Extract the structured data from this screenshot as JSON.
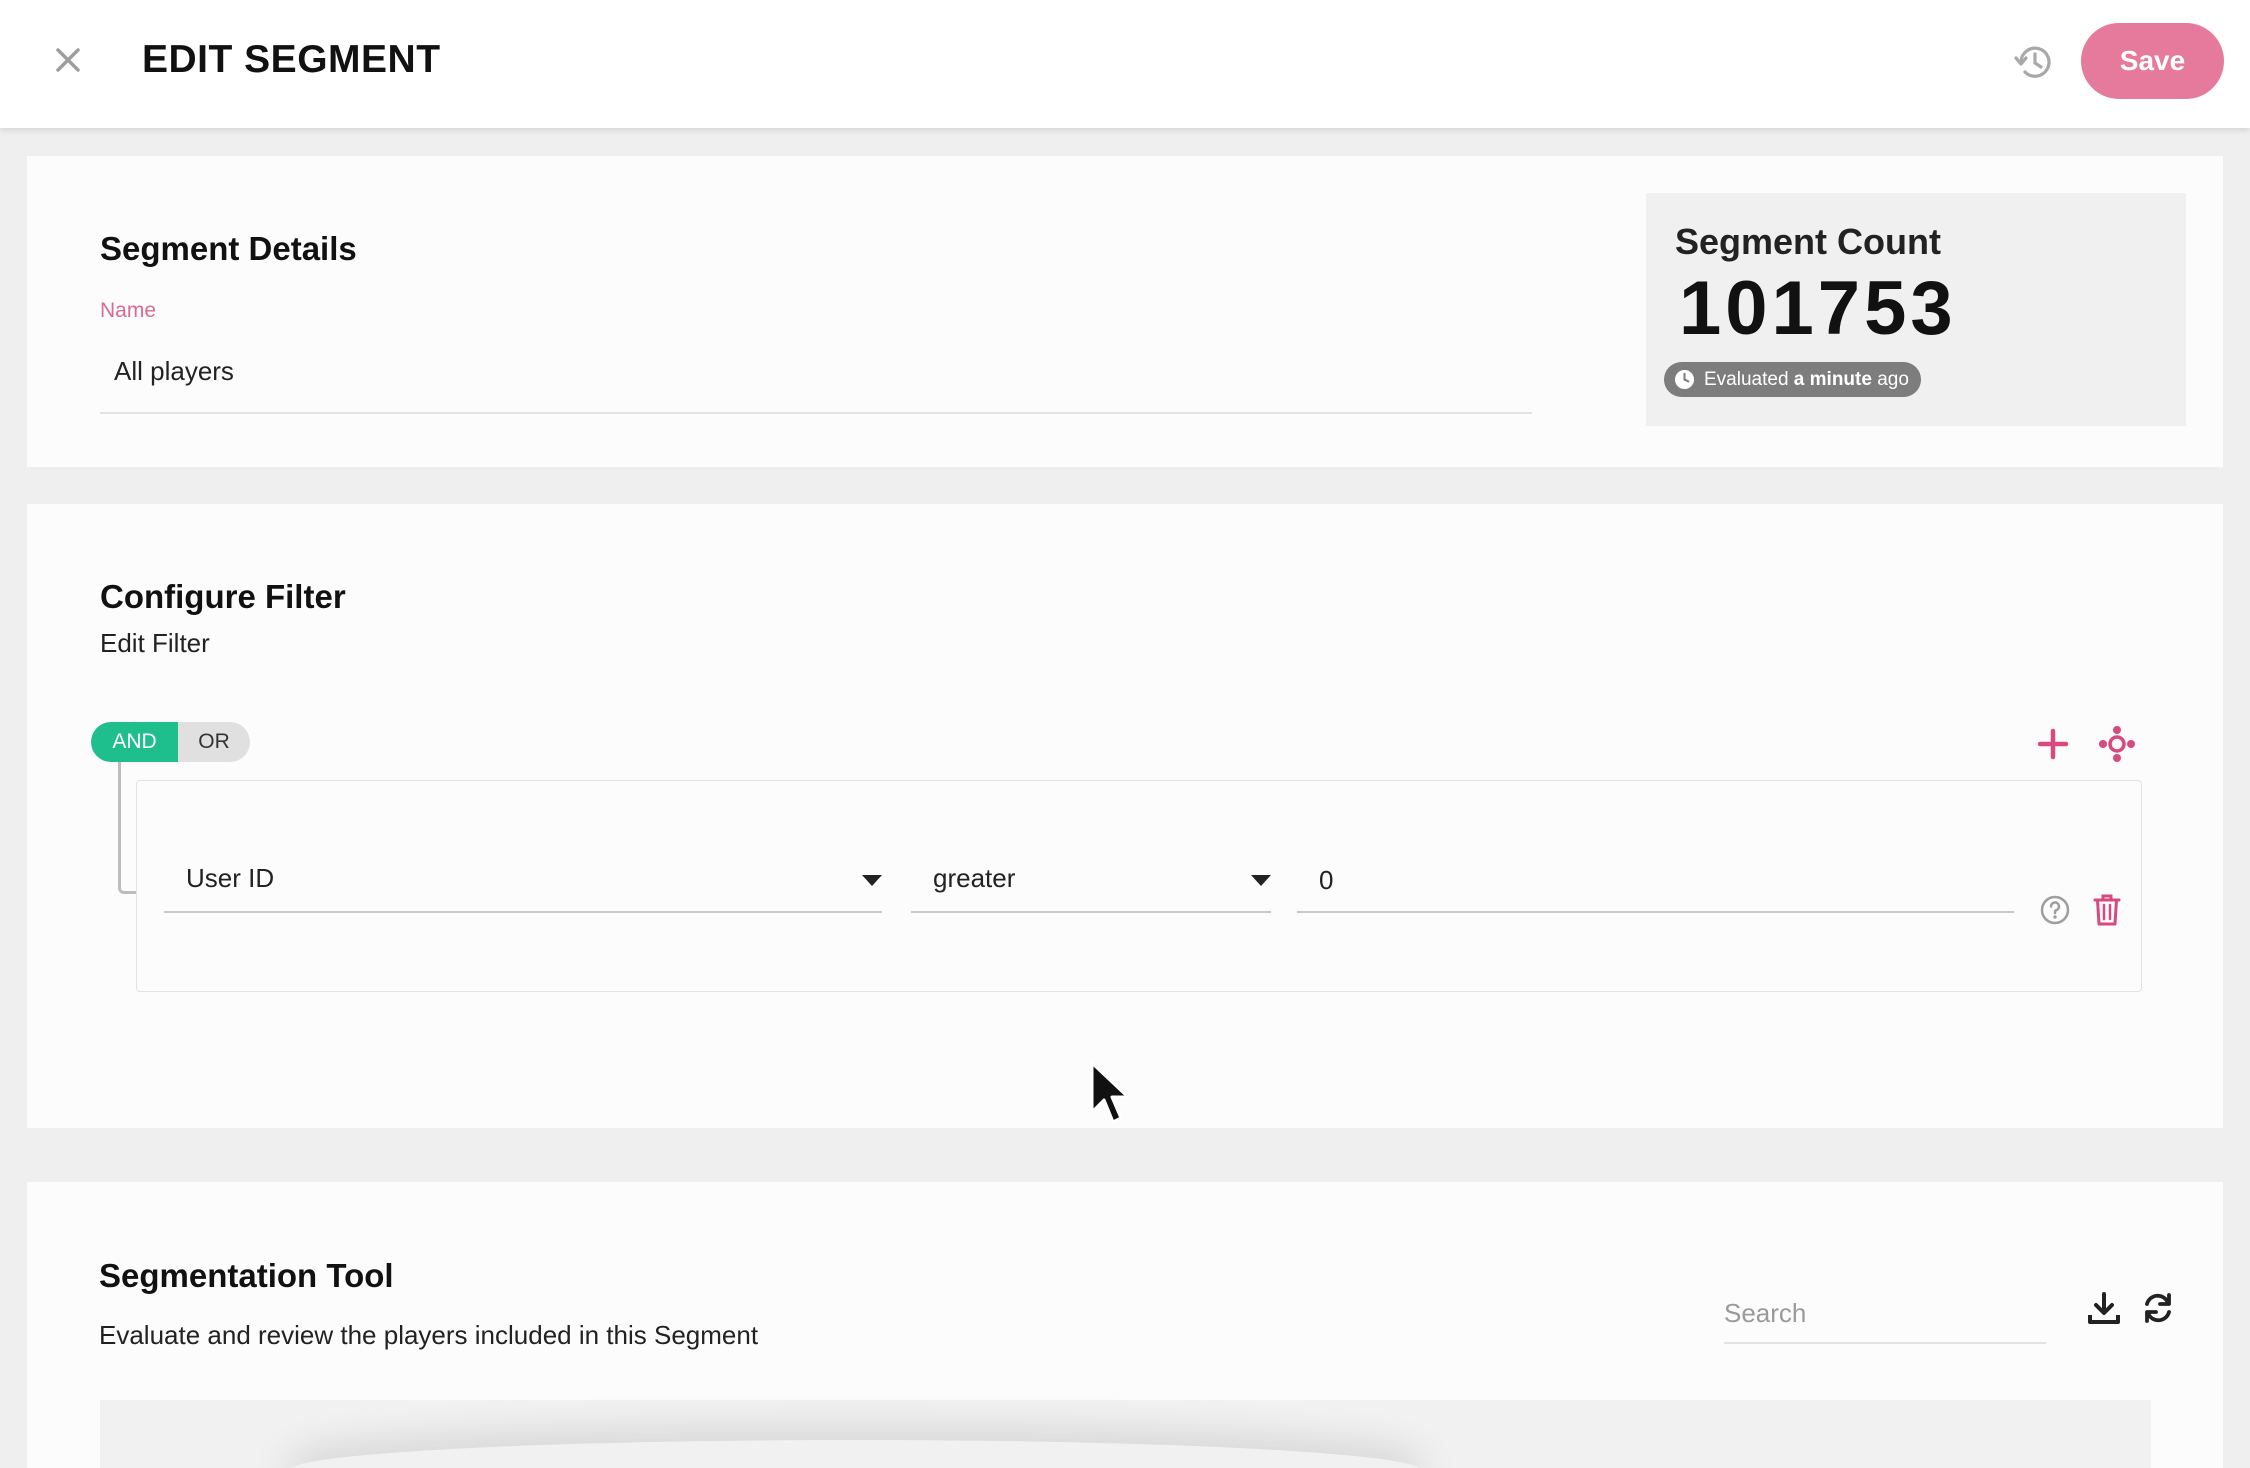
{
  "header": {
    "title": "EDIT SEGMENT",
    "save_label": "Save",
    "accent_color": "#e67a9c",
    "close_icon": "close-icon",
    "history_icon": "history-icon"
  },
  "details": {
    "title": "Segment Details",
    "name_label": "Name",
    "name_value": "All players"
  },
  "count": {
    "label": "Segment Count",
    "value": "101753",
    "evaluated_prefix": "Evaluated",
    "evaluated_bold": "a minute",
    "evaluated_suffix": "ago"
  },
  "filter": {
    "title": "Configure Filter",
    "subtitle": "Edit Filter",
    "and_label": "AND",
    "or_label": "OR",
    "active_operator": "AND",
    "active_color": "#1fbe8d",
    "rule": {
      "property": "User ID",
      "operator": "greater",
      "value": "0"
    }
  },
  "tool": {
    "title": "Segmentation Tool",
    "description": "Evaluate and review the players included in this Segment",
    "search_placeholder": "Search"
  }
}
